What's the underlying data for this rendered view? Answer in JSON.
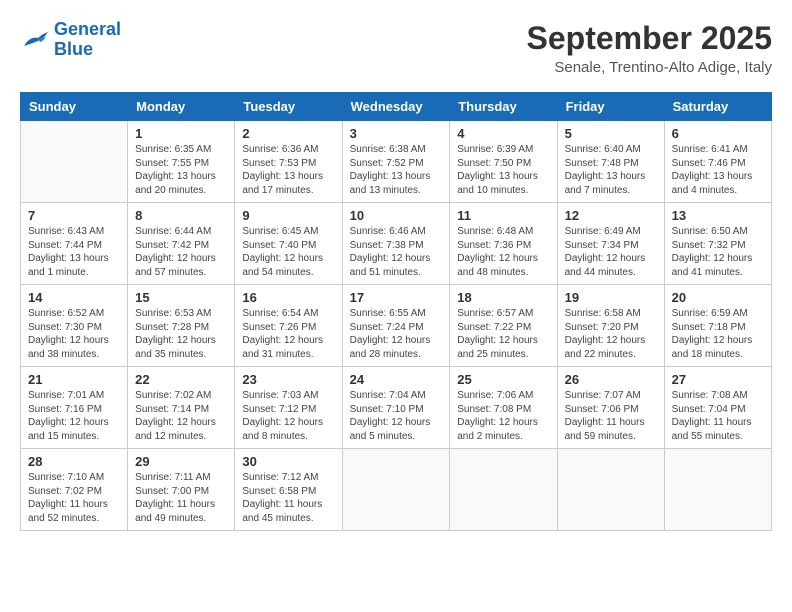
{
  "logo": {
    "line1": "General",
    "line2": "Blue"
  },
  "title": "September 2025",
  "subtitle": "Senale, Trentino-Alto Adige, Italy",
  "weekdays": [
    "Sunday",
    "Monday",
    "Tuesday",
    "Wednesday",
    "Thursday",
    "Friday",
    "Saturday"
  ],
  "weeks": [
    [
      {
        "day": "",
        "info": ""
      },
      {
        "day": "1",
        "info": "Sunrise: 6:35 AM\nSunset: 7:55 PM\nDaylight: 13 hours\nand 20 minutes."
      },
      {
        "day": "2",
        "info": "Sunrise: 6:36 AM\nSunset: 7:53 PM\nDaylight: 13 hours\nand 17 minutes."
      },
      {
        "day": "3",
        "info": "Sunrise: 6:38 AM\nSunset: 7:52 PM\nDaylight: 13 hours\nand 13 minutes."
      },
      {
        "day": "4",
        "info": "Sunrise: 6:39 AM\nSunset: 7:50 PM\nDaylight: 13 hours\nand 10 minutes."
      },
      {
        "day": "5",
        "info": "Sunrise: 6:40 AM\nSunset: 7:48 PM\nDaylight: 13 hours\nand 7 minutes."
      },
      {
        "day": "6",
        "info": "Sunrise: 6:41 AM\nSunset: 7:46 PM\nDaylight: 13 hours\nand 4 minutes."
      }
    ],
    [
      {
        "day": "7",
        "info": "Sunrise: 6:43 AM\nSunset: 7:44 PM\nDaylight: 13 hours\nand 1 minute."
      },
      {
        "day": "8",
        "info": "Sunrise: 6:44 AM\nSunset: 7:42 PM\nDaylight: 12 hours\nand 57 minutes."
      },
      {
        "day": "9",
        "info": "Sunrise: 6:45 AM\nSunset: 7:40 PM\nDaylight: 12 hours\nand 54 minutes."
      },
      {
        "day": "10",
        "info": "Sunrise: 6:46 AM\nSunset: 7:38 PM\nDaylight: 12 hours\nand 51 minutes."
      },
      {
        "day": "11",
        "info": "Sunrise: 6:48 AM\nSunset: 7:36 PM\nDaylight: 12 hours\nand 48 minutes."
      },
      {
        "day": "12",
        "info": "Sunrise: 6:49 AM\nSunset: 7:34 PM\nDaylight: 12 hours\nand 44 minutes."
      },
      {
        "day": "13",
        "info": "Sunrise: 6:50 AM\nSunset: 7:32 PM\nDaylight: 12 hours\nand 41 minutes."
      }
    ],
    [
      {
        "day": "14",
        "info": "Sunrise: 6:52 AM\nSunset: 7:30 PM\nDaylight: 12 hours\nand 38 minutes."
      },
      {
        "day": "15",
        "info": "Sunrise: 6:53 AM\nSunset: 7:28 PM\nDaylight: 12 hours\nand 35 minutes."
      },
      {
        "day": "16",
        "info": "Sunrise: 6:54 AM\nSunset: 7:26 PM\nDaylight: 12 hours\nand 31 minutes."
      },
      {
        "day": "17",
        "info": "Sunrise: 6:55 AM\nSunset: 7:24 PM\nDaylight: 12 hours\nand 28 minutes."
      },
      {
        "day": "18",
        "info": "Sunrise: 6:57 AM\nSunset: 7:22 PM\nDaylight: 12 hours\nand 25 minutes."
      },
      {
        "day": "19",
        "info": "Sunrise: 6:58 AM\nSunset: 7:20 PM\nDaylight: 12 hours\nand 22 minutes."
      },
      {
        "day": "20",
        "info": "Sunrise: 6:59 AM\nSunset: 7:18 PM\nDaylight: 12 hours\nand 18 minutes."
      }
    ],
    [
      {
        "day": "21",
        "info": "Sunrise: 7:01 AM\nSunset: 7:16 PM\nDaylight: 12 hours\nand 15 minutes."
      },
      {
        "day": "22",
        "info": "Sunrise: 7:02 AM\nSunset: 7:14 PM\nDaylight: 12 hours\nand 12 minutes."
      },
      {
        "day": "23",
        "info": "Sunrise: 7:03 AM\nSunset: 7:12 PM\nDaylight: 12 hours\nand 8 minutes."
      },
      {
        "day": "24",
        "info": "Sunrise: 7:04 AM\nSunset: 7:10 PM\nDaylight: 12 hours\nand 5 minutes."
      },
      {
        "day": "25",
        "info": "Sunrise: 7:06 AM\nSunset: 7:08 PM\nDaylight: 12 hours\nand 2 minutes."
      },
      {
        "day": "26",
        "info": "Sunrise: 7:07 AM\nSunset: 7:06 PM\nDaylight: 11 hours\nand 59 minutes."
      },
      {
        "day": "27",
        "info": "Sunrise: 7:08 AM\nSunset: 7:04 PM\nDaylight: 11 hours\nand 55 minutes."
      }
    ],
    [
      {
        "day": "28",
        "info": "Sunrise: 7:10 AM\nSunset: 7:02 PM\nDaylight: 11 hours\nand 52 minutes."
      },
      {
        "day": "29",
        "info": "Sunrise: 7:11 AM\nSunset: 7:00 PM\nDaylight: 11 hours\nand 49 minutes."
      },
      {
        "day": "30",
        "info": "Sunrise: 7:12 AM\nSunset: 6:58 PM\nDaylight: 11 hours\nand 45 minutes."
      },
      {
        "day": "",
        "info": ""
      },
      {
        "day": "",
        "info": ""
      },
      {
        "day": "",
        "info": ""
      },
      {
        "day": "",
        "info": ""
      }
    ]
  ]
}
